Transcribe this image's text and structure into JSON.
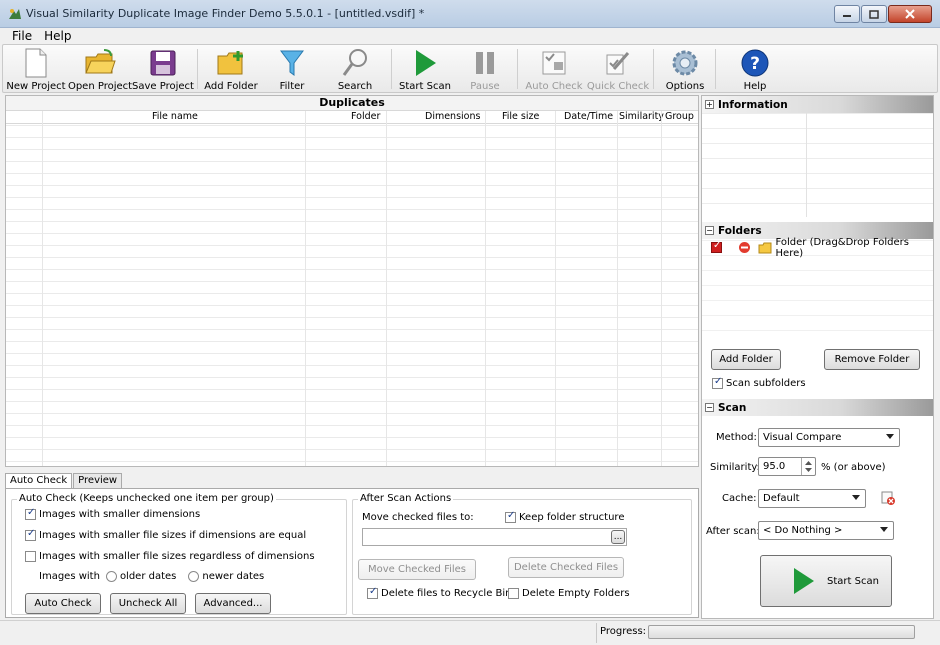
{
  "window": {
    "title": "Visual Similarity Duplicate Image Finder Demo 5.5.0.1 - [untitled.vsdif] *"
  },
  "menu": [
    "File",
    "Help"
  ],
  "toolbar": {
    "new_project": "New Project",
    "open_project": "Open Project",
    "save_project": "Save Project",
    "add_folder": "Add Folder",
    "filter": "Filter",
    "search": "Search",
    "start_scan": "Start Scan",
    "pause": "Pause",
    "auto_check": "Auto Check",
    "quick_check": "Quick Check",
    "options": "Options",
    "help": "Help"
  },
  "duplicates": {
    "title": "Duplicates",
    "columns": [
      "File name",
      "Folder",
      "Dimensions",
      "File size",
      "Date/Time",
      "Similarity",
      "Group"
    ]
  },
  "bottom_tabs": [
    "Auto Check",
    "Preview"
  ],
  "auto_check": {
    "group_title": "Auto Check (Keeps unchecked one item per group)",
    "opt_smaller_dims": "Images with smaller dimensions",
    "opt_smaller_dims_checked": true,
    "opt_smaller_size_eq": "Images with smaller file sizes if dimensions are equal",
    "opt_smaller_size_eq_checked": true,
    "opt_smaller_size_any": "Images with smaller file sizes regardless of dimensions",
    "opt_smaller_size_any_checked": false,
    "images_with": "Images with",
    "older_dates": "older dates",
    "newer_dates": "newer dates",
    "btn_auto_check": "Auto Check",
    "btn_uncheck_all": "Uncheck All",
    "btn_advanced": "Advanced..."
  },
  "after_scan_actions": {
    "group_title": "After Scan Actions",
    "move_checked_label": "Move checked files to:",
    "keep_structure": "Keep folder structure",
    "keep_structure_checked": true,
    "path_value": "",
    "browse": "...",
    "btn_move": "Move Checked Files",
    "btn_delete": "Delete Checked Files",
    "recycle_bin": "Delete files to Recycle Bin",
    "recycle_bin_checked": true,
    "delete_empty": "Delete Empty Folders",
    "delete_empty_checked": false
  },
  "status": {
    "progress_label": "Progress:",
    "progress": 0
  },
  "information": {
    "title": "Information",
    "toggle": "+"
  },
  "folders": {
    "title": "Folders",
    "toggle": "−",
    "row_label": "Folder (Drag&Drop Folders Here)",
    "btn_add": "Add Folder",
    "btn_remove": "Remove Folder",
    "scan_subfolders": "Scan subfolders",
    "scan_subfolders_checked": true
  },
  "scan": {
    "title": "Scan",
    "toggle": "−",
    "method_label": "Method:",
    "method_value": "Visual Compare",
    "similarity_label": "Similarity:",
    "similarity_value": "95.0",
    "similarity_suffix": "% (or above)",
    "cache_label": "Cache:",
    "cache_value": "Default",
    "after_scan_label": "After scan:",
    "after_scan_value": "< Do Nothing >",
    "start_scan": "Start Scan"
  },
  "colors": {
    "scan_green": "#1f9a3a",
    "help_blue": "#1d56b8",
    "folder_yellow": "#f5c842",
    "filter_blue": "#3a9ad9"
  }
}
